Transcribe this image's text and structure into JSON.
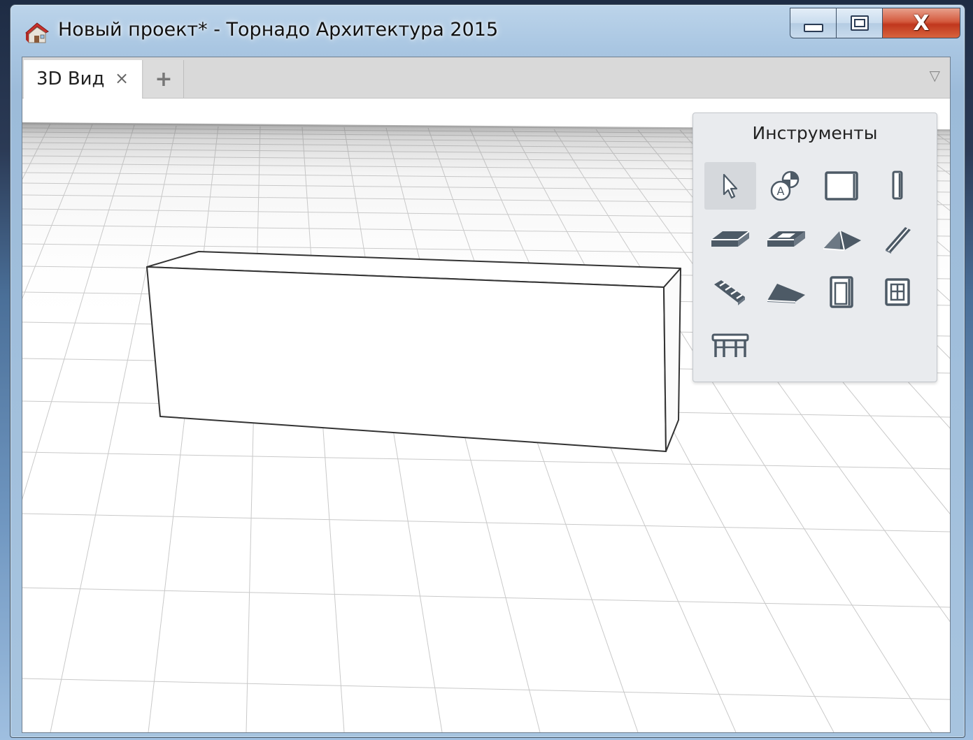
{
  "window": {
    "title": "Новый проект* - Торнадо Архитектура 2015",
    "controls": {
      "minimize_icon": "minimize-icon",
      "maximize_icon": "restore-icon",
      "close_label": "X"
    }
  },
  "tabs": [
    {
      "label": "3D Вид",
      "close_label": "×",
      "active": true
    }
  ],
  "tabbar": {
    "add_label": "+",
    "dropdown_label": "▽"
  },
  "tools_panel": {
    "title": "Инструменты",
    "tools": [
      {
        "icon": "select-arrow-icon",
        "active": true
      },
      {
        "icon": "snap-objects-icon",
        "active": false
      },
      {
        "icon": "room-icon",
        "active": false
      },
      {
        "icon": "column-icon",
        "active": false
      },
      {
        "icon": "slab-icon",
        "active": false
      },
      {
        "icon": "slab-opening-icon",
        "active": false
      },
      {
        "icon": "roof-icon",
        "active": false
      },
      {
        "icon": "beam-icon",
        "active": false
      },
      {
        "icon": "stairs-icon",
        "active": false
      },
      {
        "icon": "ramp-icon",
        "active": false
      },
      {
        "icon": "door-icon",
        "active": false
      },
      {
        "icon": "window-icon",
        "active": false
      },
      {
        "icon": "furniture-table-icon",
        "active": false
      }
    ]
  },
  "colors": {
    "close_button": "#c0371d",
    "tool_icon": "#4d5a66",
    "panel_bg": "#e9ebee"
  }
}
